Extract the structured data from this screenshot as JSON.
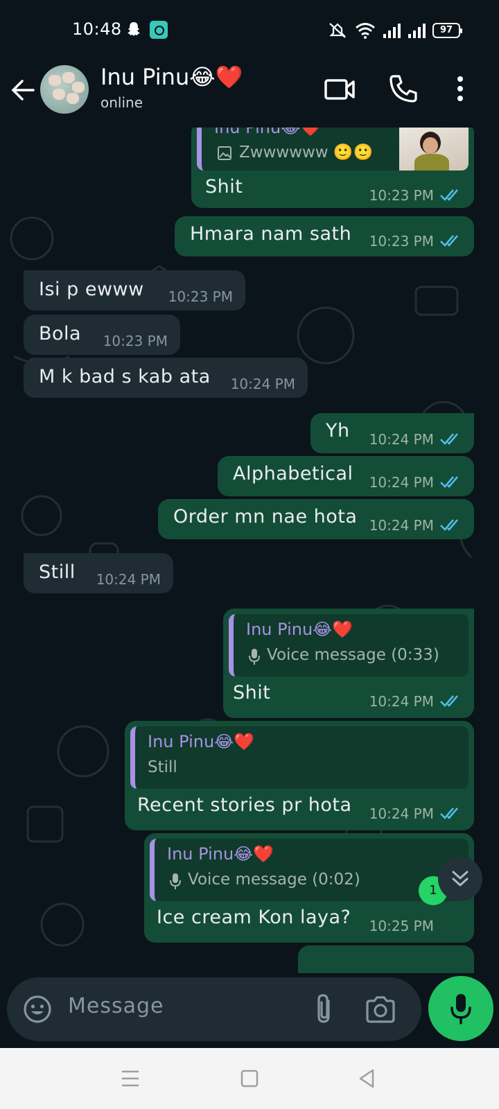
{
  "status_bar": {
    "time": "10:48",
    "battery": "97",
    "icons": [
      "snapchat-icon",
      "app-icon",
      "mute-icon",
      "wifi-icon",
      "signal-icon",
      "signal-icon",
      "battery-icon"
    ]
  },
  "header": {
    "contact_name": "Inu Pinu😂❤️",
    "status": "online",
    "icons": [
      "back-arrow-icon",
      "video-call-icon",
      "voice-call-icon",
      "more-vert-icon"
    ]
  },
  "messages": [
    {
      "dir": "out",
      "quote_name": "Inu Pinu😂❤️",
      "quote_text": "Zwwwwww 🙂🙂",
      "text": "Shit",
      "time": "10:23 PM"
    },
    {
      "dir": "out",
      "text": "Hmara nam sath",
      "time": "10:23 PM"
    },
    {
      "dir": "in",
      "text": "Isi p ewww",
      "time": "10:23 PM"
    },
    {
      "dir": "in",
      "text": "Bola",
      "time": "10:23 PM"
    },
    {
      "dir": "in",
      "text": "M k bad s kab ata",
      "time": "10:24 PM"
    },
    {
      "dir": "out",
      "text": "Yh",
      "time": "10:24 PM"
    },
    {
      "dir": "out",
      "text": "Alphabetical",
      "time": "10:24 PM"
    },
    {
      "dir": "out",
      "text": "Order mn nae hota",
      "time": "10:24 PM"
    },
    {
      "dir": "in",
      "text": "Still",
      "time": "10:24 PM"
    },
    {
      "dir": "out",
      "quote_name": "Inu Pinu😂❤️",
      "quote_text": "Voice message (0:33)",
      "text": "Shit",
      "time": "10:24 PM"
    },
    {
      "dir": "out",
      "quote_name": "Inu Pinu😂❤️",
      "quote_text": "Still",
      "text": "Recent stories pr hota",
      "time": "10:24 PM"
    },
    {
      "dir": "out",
      "quote_name": "Inu Pinu😂❤️",
      "quote_text": "Voice message (0:02)",
      "text": "Ice cream Kon laya?",
      "time": "10:25 PM"
    }
  ],
  "unread_count": "1",
  "input": {
    "placeholder": "Message"
  },
  "colors": {
    "background": "#0b141a",
    "outgoing_bubble": "#144d37",
    "incoming_bubble": "#1f2c34",
    "quote_accent": "#a792e6",
    "read_ticks": "#53bdeb",
    "mic_button": "#21c063"
  }
}
